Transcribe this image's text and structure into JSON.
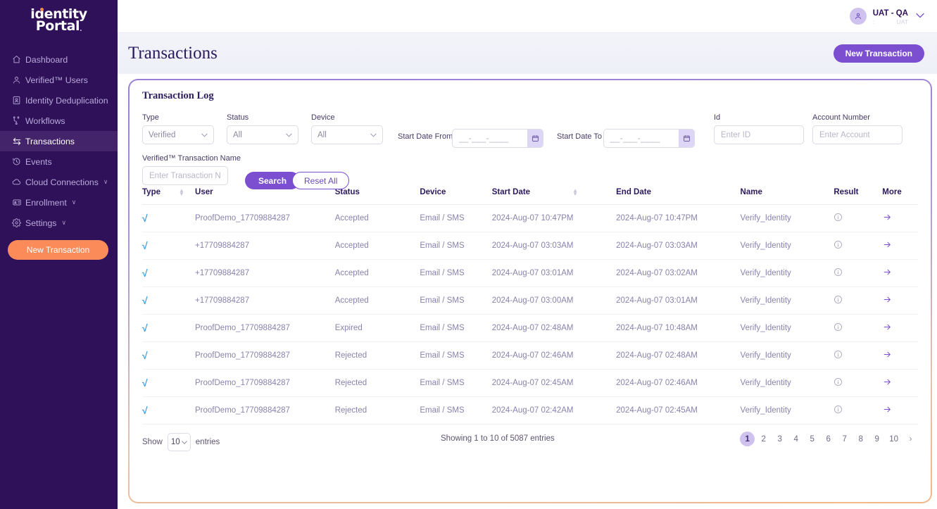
{
  "brand": {
    "logo_line1": "identity",
    "logo_line2": "Portal",
    "logo_tm": ".",
    "accent_purple": "#7b4fd0",
    "accent_orange": "#fb8c5a",
    "sidebar_bg": "#2f1159"
  },
  "sidebar": {
    "items": [
      {
        "label": "Dashboard",
        "icon": "home-icon",
        "active": false,
        "chevron": ""
      },
      {
        "label": "Verified™ Users",
        "icon": "user-icon",
        "active": false,
        "chevron": ""
      },
      {
        "label": "Identity Deduplication",
        "icon": "id-card-icon",
        "active": false,
        "chevron": ""
      },
      {
        "label": "Workflows",
        "icon": "workflow-icon",
        "active": false,
        "chevron": ""
      },
      {
        "label": "Transactions",
        "icon": "transactions-arrows-icon",
        "active": true,
        "chevron": ""
      },
      {
        "label": "Events",
        "icon": "clock-history-icon",
        "active": false,
        "chevron": ""
      },
      {
        "label": "Cloud Connections",
        "icon": "cloud-icon",
        "active": false,
        "chevron": "∨"
      },
      {
        "label": "Enrollment",
        "icon": "enrollment-card-icon",
        "active": false,
        "chevron": "∨"
      },
      {
        "label": "Settings",
        "icon": "gear-icon",
        "active": false,
        "chevron": "∨"
      }
    ],
    "new_transaction_label": "New Transaction"
  },
  "topbar": {
    "user_name": "UAT - QA",
    "user_sub_left": ":",
    "user_sub_right": "UAT",
    "avatar_icon": "person-icon",
    "chevron_icon": "chevron-down-icon"
  },
  "page": {
    "title": "Transactions",
    "new_transaction_label": "New Transaction"
  },
  "card": {
    "title": "Transaction Log"
  },
  "filters": {
    "type": {
      "label": "Type",
      "value": "Verified"
    },
    "status": {
      "label": "Status",
      "value": "All"
    },
    "device": {
      "label": "Device",
      "value": "All"
    },
    "start_date_from": {
      "label": "Start Date From",
      "value": "__-___-____"
    },
    "start_date_to": {
      "label": "Start Date To",
      "value": "__-___-____"
    },
    "id": {
      "label": "Id",
      "placeholder": "Enter ID",
      "value": ""
    },
    "account_number": {
      "label": "Account Number",
      "placeholder": "Enter Account",
      "value": ""
    },
    "transaction_name": {
      "label": "Verified™ Transaction Name",
      "placeholder": "Enter Transaction Name",
      "value": ""
    },
    "search_label": "Search",
    "reset_label": "Reset All"
  },
  "table": {
    "columns": [
      {
        "key": "type",
        "label": "Type",
        "sortable": true
      },
      {
        "key": "user",
        "label": "User",
        "sortable": false
      },
      {
        "key": "status",
        "label": "Status",
        "sortable": false
      },
      {
        "key": "device",
        "label": "Device",
        "sortable": false
      },
      {
        "key": "start_date",
        "label": "Start Date",
        "sortable": true
      },
      {
        "key": "end_date",
        "label": "End Date",
        "sortable": false
      },
      {
        "key": "name",
        "label": "Name",
        "sortable": false
      },
      {
        "key": "result",
        "label": "Result",
        "sortable": false
      },
      {
        "key": "more",
        "label": "More",
        "sortable": false
      }
    ],
    "rows": [
      {
        "type": "√",
        "user": "ProofDemo_17709884287",
        "status": "Accepted",
        "device": "Email / SMS",
        "start_date": "2024-Aug-07 10:47PM",
        "end_date": "2024-Aug-07 10:47PM",
        "name": "Verify_Identity",
        "result": "info-icon",
        "more": "arrow-right-icon"
      },
      {
        "type": "√",
        "user": "+17709884287",
        "status": "Accepted",
        "device": "Email / SMS",
        "start_date": "2024-Aug-07 03:03AM",
        "end_date": "2024-Aug-07 03:03AM",
        "name": "Verify_Identity",
        "result": "info-icon",
        "more": "arrow-right-icon"
      },
      {
        "type": "√",
        "user": "+17709884287",
        "status": "Accepted",
        "device": "Email / SMS",
        "start_date": "2024-Aug-07 03:01AM",
        "end_date": "2024-Aug-07 03:02AM",
        "name": "Verify_Identity",
        "result": "info-icon",
        "more": "arrow-right-icon"
      },
      {
        "type": "√",
        "user": "+17709884287",
        "status": "Accepted",
        "device": "Email / SMS",
        "start_date": "2024-Aug-07 03:00AM",
        "end_date": "2024-Aug-07 03:01AM",
        "name": "Verify_Identity",
        "result": "info-icon",
        "more": "arrow-right-icon"
      },
      {
        "type": "√",
        "user": "ProofDemo_17709884287",
        "status": "Expired",
        "device": "Email / SMS",
        "start_date": "2024-Aug-07 02:48AM",
        "end_date": "2024-Aug-07 10:48AM",
        "name": "Verify_Identity",
        "result": "info-icon",
        "more": "arrow-right-icon"
      },
      {
        "type": "√",
        "user": "ProofDemo_17709884287",
        "status": "Rejected",
        "device": "Email / SMS",
        "start_date": "2024-Aug-07 02:46AM",
        "end_date": "2024-Aug-07 02:48AM",
        "name": "Verify_Identity",
        "result": "info-icon",
        "more": "arrow-right-icon"
      },
      {
        "type": "√",
        "user": "ProofDemo_17709884287",
        "status": "Rejected",
        "device": "Email / SMS",
        "start_date": "2024-Aug-07 02:45AM",
        "end_date": "2024-Aug-07 02:46AM",
        "name": "Verify_Identity",
        "result": "info-icon",
        "more": "arrow-right-icon"
      },
      {
        "type": "√",
        "user": "ProofDemo_17709884287",
        "status": "Rejected",
        "device": "Email / SMS",
        "start_date": "2024-Aug-07 02:42AM",
        "end_date": "2024-Aug-07 02:45AM",
        "name": "Verify_Identity",
        "result": "info-icon",
        "more": "arrow-right-icon"
      }
    ]
  },
  "footer": {
    "show_label": "Show",
    "entries_label": "entries",
    "page_size": "10",
    "showing_text": "Showing 1 to 10 of 5087 entries",
    "pages": [
      "1",
      "2",
      "3",
      "4",
      "5",
      "6",
      "7",
      "8",
      "9",
      "10"
    ],
    "active_page": "1",
    "next_label": "›"
  }
}
